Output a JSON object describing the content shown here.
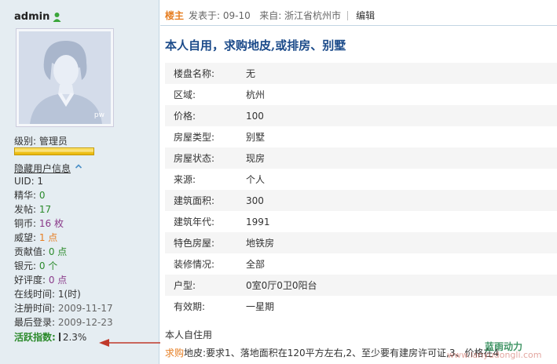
{
  "profile": {
    "username": "admin",
    "avatar_badge": "pw",
    "level_label": "级别: 管理员",
    "hide_info_link": "隐藏用户信息",
    "stats": [
      {
        "key": "UID: ",
        "value": "1",
        "color": "dark"
      },
      {
        "key": "精华: ",
        "value": "0",
        "color": "green"
      },
      {
        "key": "发帖: ",
        "value": "17",
        "color": "green"
      },
      {
        "key": "铜币: ",
        "value": "16 枚",
        "color": "purple"
      },
      {
        "key": "威望: ",
        "value": "1 点",
        "color": "orange"
      },
      {
        "key": "贡献值: ",
        "value": "0 点",
        "color": "green"
      },
      {
        "key": "银元: ",
        "value": "0 个",
        "color": "green"
      },
      {
        "key": "好评度: ",
        "value": "0 点",
        "color": "purple"
      },
      {
        "key": "在线时间: ",
        "value": "1(时)",
        "color": "dark"
      },
      {
        "key": "注册时间: ",
        "value": "2009-11-17",
        "color": "gray"
      },
      {
        "key": "最后登录: ",
        "value": "2009-12-23",
        "color": "gray"
      }
    ],
    "activity_label": "活跃指数:",
    "activity_value": "2.3%"
  },
  "post": {
    "louzhu": "楼主",
    "posted_at": "发表于: 09-10",
    "source": "来自: 浙江省杭州市",
    "edit_label": "编辑",
    "title": "本人自用，求购地皮,或排房、别墅",
    "fields": [
      {
        "key": "楼盘名称:",
        "value": "无"
      },
      {
        "key": "区域:",
        "value": "杭州"
      },
      {
        "key": "价格:",
        "value": "100"
      },
      {
        "key": "房屋类型:",
        "value": "别墅"
      },
      {
        "key": "房屋状态:",
        "value": "现房"
      },
      {
        "key": "来源:",
        "value": "个人"
      },
      {
        "key": "建筑面积:",
        "value": "300"
      },
      {
        "key": "建筑年代:",
        "value": "1991"
      },
      {
        "key": "特色房屋:",
        "value": "地铁房"
      },
      {
        "key": "装修情况:",
        "value": "全部"
      },
      {
        "key": "户型:",
        "value": "0室0厅0卫0阳台"
      },
      {
        "key": "有效期:",
        "value": "一星期"
      }
    ],
    "desc_line1": "本人自住用",
    "desc_prefix": "求购",
    "desc_line2": "地皮:要求1、落地面积在120平方左右,2、至少要有建房许可证,3、价格在4"
  },
  "watermark": {
    "cn": "蓝雨动力",
    "url": "www.lanyudongli.com"
  },
  "colors": {
    "sidebar_bg": "#e5edf2",
    "title_blue": "#1c4b8a",
    "louzhu_orange": "#e67e22",
    "value_green": "#2b8a2b",
    "arrow_red": "#c0392b"
  }
}
